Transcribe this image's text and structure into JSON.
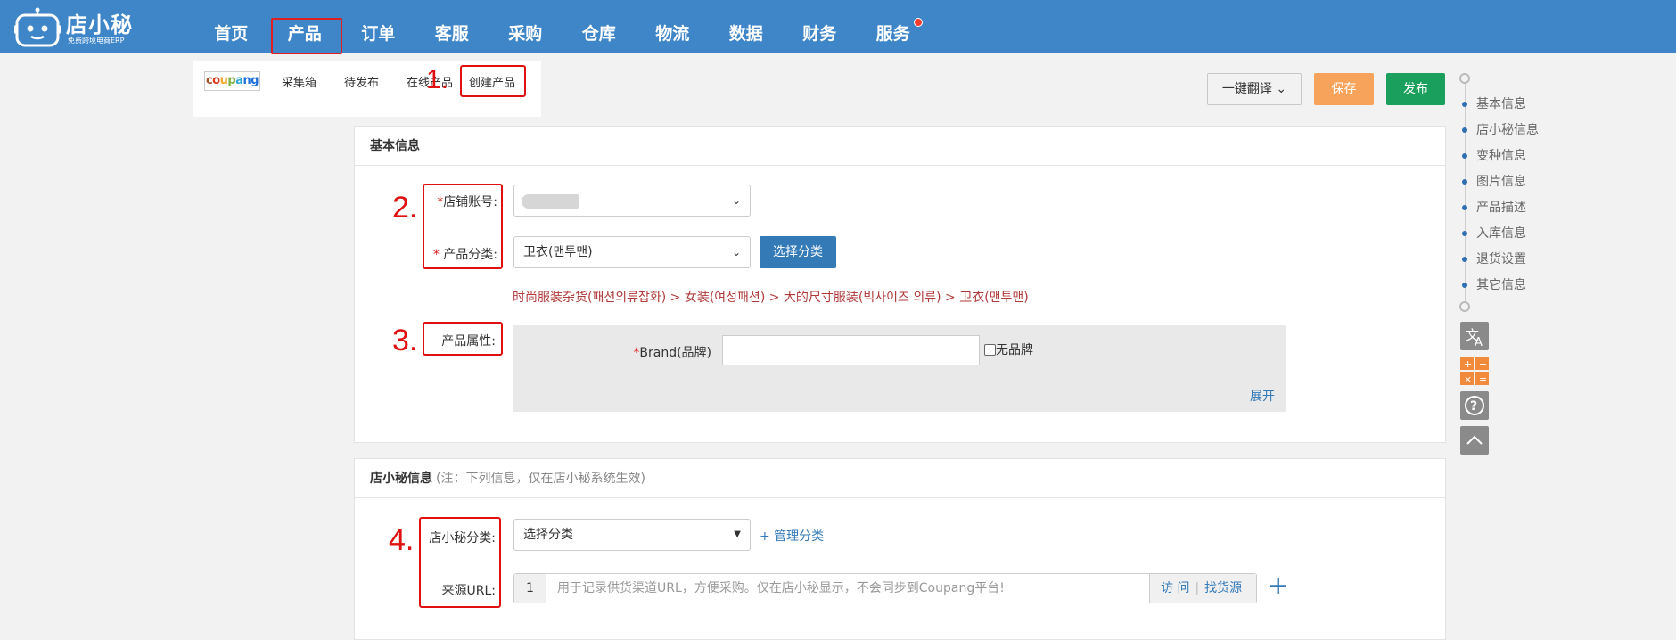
{
  "logo": {
    "brand": "店小秘",
    "tagline": "免费跨境电商ERP"
  },
  "nav": [
    "首页",
    "产品",
    "订单",
    "客服",
    "采购",
    "仓库",
    "物流",
    "数据",
    "财务",
    "服务"
  ],
  "nav_active_index": 1,
  "subtabs": {
    "coupang_letters": [
      "c",
      "o",
      "u",
      "p",
      "a",
      "n",
      "g"
    ],
    "items": [
      "采集箱",
      "待发布",
      "在线产品",
      "创建产品"
    ]
  },
  "annotations": [
    "1.",
    "2.",
    "3.",
    "4."
  ],
  "actions": {
    "translate": "一键翻译",
    "save": "保存",
    "publish": "发布"
  },
  "basic": {
    "title": "基本信息",
    "shop_label": "店铺账号:",
    "category_label": "产品分类:",
    "category_value": "卫衣(맨투맨)",
    "choose_category": "选择分类",
    "category_path": "时尚服装杂货(패션의류잡화) > 女装(여성패션) > 大的尺寸服装(빅사이즈 의류) > 卫衣(맨투맨)",
    "attr_label": "产品属性:",
    "brand_label": "Brand(品牌)",
    "no_brand": "无品牌",
    "expand": "展开"
  },
  "dxm": {
    "title": "店小秘信息",
    "note": "(注：下列信息，仅在店小秘系统生效)",
    "category_label": "店小秘分类:",
    "category_placeholder": "选择分类",
    "manage": "+ 管理分类",
    "url_label": "来源URL:",
    "url_index": "1",
    "url_placeholder": "用于记录供货渠道URL，方便采购。仅在店小秘显示，不会同步到Coupang平台!",
    "visit": "访 问",
    "find_source": "找货源"
  },
  "sidenav": [
    "基本信息",
    "店小秘信息",
    "变种信息",
    "图片信息",
    "产品描述",
    "入库信息",
    "退货设置",
    "其它信息"
  ],
  "tools": [
    "translate-icon",
    "calculator-icon",
    "help-icon",
    "back-to-top-icon"
  ],
  "colors": {
    "topbar": "#3f86c9",
    "save": "#f7a35c",
    "publish": "#1aa05c",
    "primary": "#337ab7",
    "annotation": "#e01010"
  }
}
